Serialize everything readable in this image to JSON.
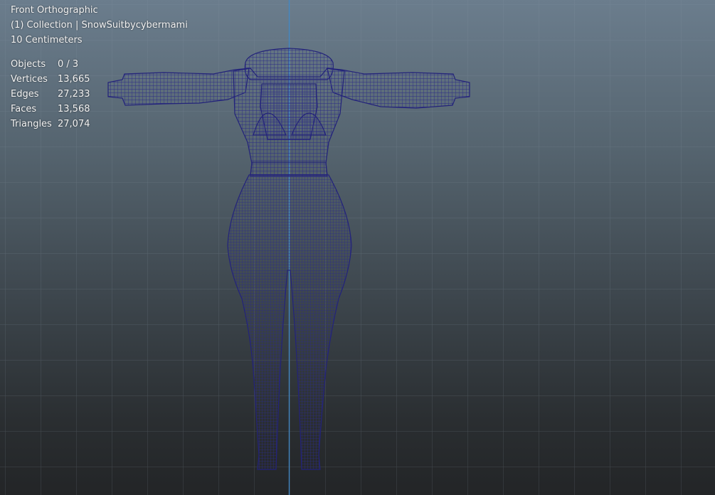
{
  "viewport": {
    "view_name": "Front Orthographic",
    "collection": "(1) Collection | SnowSuitbycybermami",
    "scale": "10 Centimeters",
    "stats": [
      {
        "label": "Objects",
        "value": "0 / 3"
      },
      {
        "label": "Vertices",
        "value": "13,665"
      },
      {
        "label": "Edges",
        "value": "27,233"
      },
      {
        "label": "Faces",
        "value": "13,568"
      },
      {
        "label": "Triangles",
        "value": "27,074"
      }
    ]
  },
  "colors": {
    "wireframe": "#2a2a7a",
    "grid": "#7a8a99",
    "z_axis": "#3f86c4",
    "text": "#f2f2f2"
  }
}
